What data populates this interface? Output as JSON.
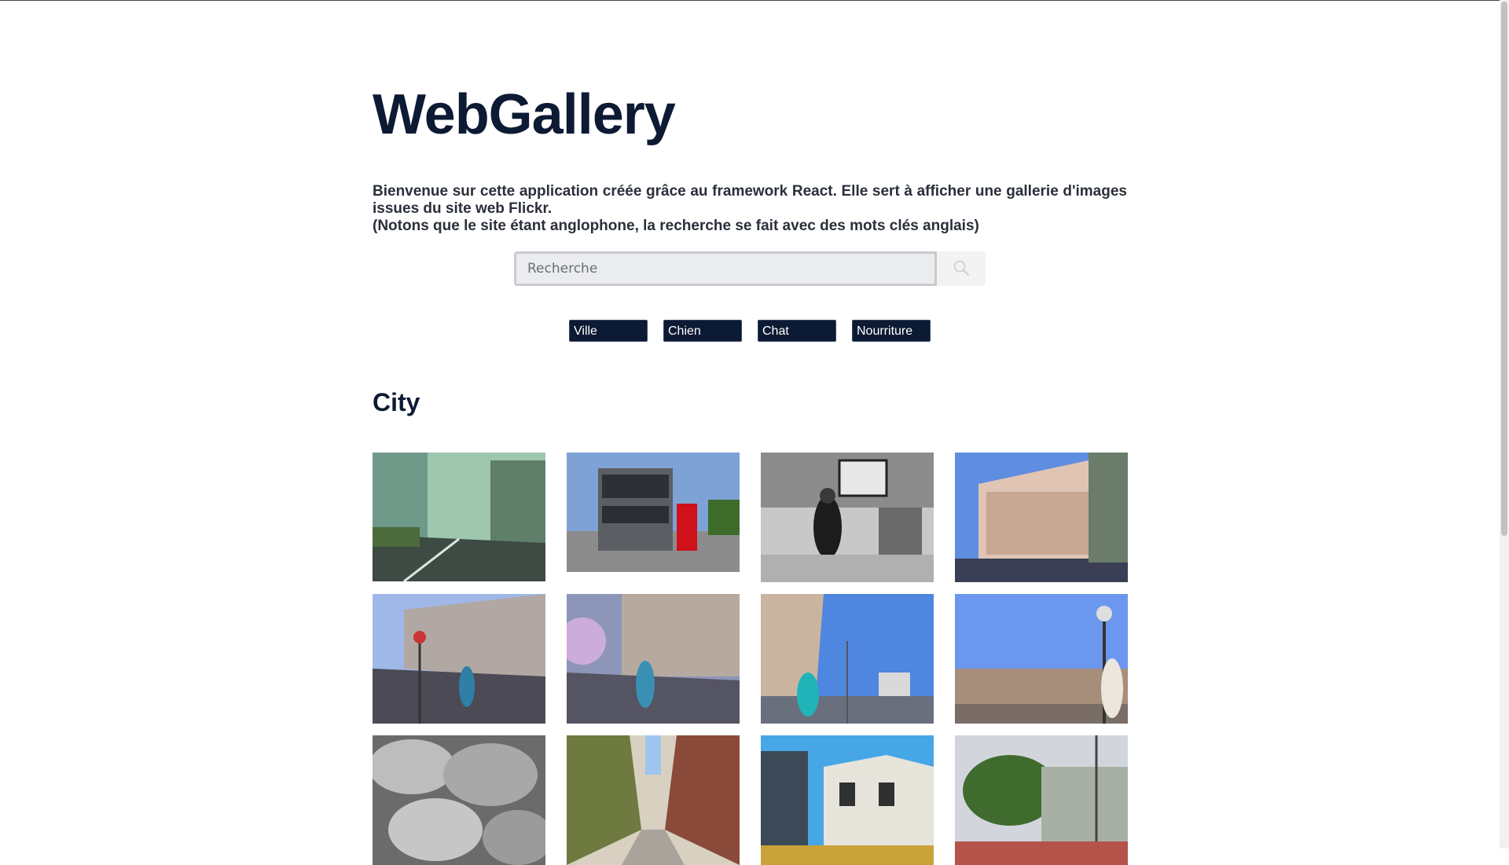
{
  "title": "WebGallery",
  "intro": {
    "line1": "Bienvenue sur cette application créée grâce au framework React. Elle sert à afficher une gallerie d'images issues du site web Flickr.",
    "line2": "(Notons que le site étant anglophone, la recherche se fait avec des mots clés anglais)"
  },
  "search": {
    "placeholder": "Recherche",
    "icon": "search-icon"
  },
  "tags": [
    "Ville",
    "Chien",
    "Chat",
    "Nourriture"
  ],
  "section_title": "City",
  "photos": [
    {
      "subject": "street-cyan"
    },
    {
      "subject": "bus-postbox"
    },
    {
      "subject": "man-armchair-bw"
    },
    {
      "subject": "pink-building"
    },
    {
      "subject": "street-woman-1"
    },
    {
      "subject": "street-woman-2"
    },
    {
      "subject": "woman-sea"
    },
    {
      "subject": "lamp-post"
    },
    {
      "subject": "rocks"
    },
    {
      "subject": "narrow-street"
    },
    {
      "subject": "white-building"
    },
    {
      "subject": "garden-trees"
    }
  ],
  "colors": {
    "primary": "#0c1a33",
    "accent_bg": "#ebecee"
  }
}
